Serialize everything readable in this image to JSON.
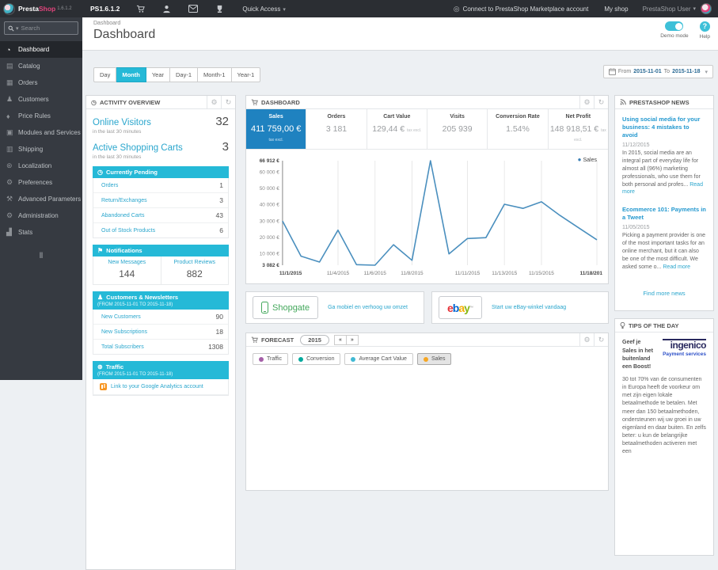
{
  "topbar": {
    "brand_presta": "Presta",
    "brand_shop": "Shop",
    "brand_version": "1.6.1.2",
    "shop_name": "PS1.6.1.2",
    "quick_access": "Quick Access",
    "connect_link": "Connect to PrestaShop Marketplace account",
    "my_shop": "My shop",
    "user_name": "PrestaShop User"
  },
  "sidebar": {
    "search_placeholder": "Search",
    "items": [
      {
        "label": "Dashboard"
      },
      {
        "label": "Catalog"
      },
      {
        "label": "Orders"
      },
      {
        "label": "Customers"
      },
      {
        "label": "Price Rules"
      },
      {
        "label": "Modules and Services"
      },
      {
        "label": "Shipping"
      },
      {
        "label": "Localization"
      },
      {
        "label": "Preferences"
      },
      {
        "label": "Advanced Parameters"
      },
      {
        "label": "Administration"
      },
      {
        "label": "Stats"
      }
    ]
  },
  "icons": {
    "dashboard": "◔",
    "catalog": "▤",
    "orders": "▦",
    "customers": "♟",
    "price_rules": "♦",
    "modules": "▣",
    "shipping": "▥",
    "localization": "⊛",
    "preferences": "⚙",
    "advanced": "⚒",
    "administration": "⚙",
    "stats": "▟",
    "gear": "⚙",
    "refresh": "↻",
    "caret_down": "▾",
    "clock": "◷",
    "bell": "⚑",
    "person": "♟",
    "globe": "⊛",
    "dot": "●",
    "collapse": "‖",
    "prev": "«",
    "next": "»",
    "connect": "◎",
    "help": "?"
  },
  "header": {
    "breadcrumb": "Dashboard",
    "title": "Dashboard",
    "demo_mode": "Demo mode",
    "help": "Help"
  },
  "toolbar": {
    "range_buttons": [
      "Day",
      "Month",
      "Year",
      "Day-1",
      "Month-1",
      "Year-1"
    ],
    "active_range": "Month",
    "from_label": "From",
    "date_from": "2015-11-01",
    "to_label": "To",
    "date_to": "2015-11-18"
  },
  "activity": {
    "title": "ACTIVITY OVERVIEW",
    "online_visitors_label": "Online Visitors",
    "online_visitors_sub": "in the last 30 minutes",
    "online_visitors": "32",
    "active_carts_label": "Active Shopping Carts",
    "active_carts_sub": "in the last 30 minutes",
    "active_carts": "3",
    "pending": {
      "title": "Currently Pending",
      "rows": [
        [
          "Orders",
          "1"
        ],
        [
          "Return/Exchanges",
          "3"
        ],
        [
          "Abandoned Carts",
          "43"
        ],
        [
          "Out of Stock Products",
          "6"
        ]
      ]
    },
    "notifications": {
      "title": "Notifications",
      "cols": [
        [
          "New Messages",
          "144"
        ],
        [
          "Product Reviews",
          "882"
        ]
      ]
    },
    "customers": {
      "title": "Customers & Newsletters",
      "subtitle": "(FROM 2015-11-01 TO 2015-11-18)",
      "rows": [
        [
          "New Customers",
          "90"
        ],
        [
          "New Subscriptions",
          "18"
        ],
        [
          "Total Subscribers",
          "1308"
        ]
      ]
    },
    "traffic": {
      "title": "Traffic",
      "subtitle": "(FROM 2015-11-01 TO 2015-11-18)",
      "link": "Link to your Google Analytics account"
    }
  },
  "dashboard_panel": {
    "title": "DASHBOARD",
    "kpis": [
      {
        "label": "Sales",
        "value": "411 759,00 €",
        "suffix": "tax excl."
      },
      {
        "label": "Orders",
        "value": "3 181",
        "suffix": ""
      },
      {
        "label": "Cart Value",
        "value": "129,44 €",
        "suffix": "tax excl."
      },
      {
        "label": "Visits",
        "value": "205 939",
        "suffix": ""
      },
      {
        "label": "Conversion Rate",
        "value": "1.54%",
        "suffix": ""
      },
      {
        "label": "Net Profit",
        "value": "148 918,51 €",
        "suffix": "tax excl."
      }
    ],
    "legend": "Sales"
  },
  "chart_data": {
    "type": "line",
    "title": "Sales",
    "x": [
      "11/1/2015",
      "11/2/2015",
      "11/3/2015",
      "11/4/2015",
      "11/5/2015",
      "11/6/2015",
      "11/7/2015",
      "11/8/2015",
      "11/9/2015",
      "11/10/2015",
      "11/11/2015",
      "11/12/2015",
      "11/13/2015",
      "11/14/2015",
      "11/15/2015",
      "11/16/2015",
      "11/17/2015",
      "11/18/2015"
    ],
    "series": [
      {
        "name": "Sales",
        "color": "#4a8fbe",
        "values": [
          30000,
          8600,
          5000,
          24500,
          3400,
          3082,
          15600,
          6100,
          66912,
          10000,
          19400,
          19900,
          40300,
          37800,
          41800,
          33500,
          26000,
          18600
        ]
      }
    ],
    "x_tick_idx": [
      0,
      3,
      5,
      7,
      10,
      12,
      14,
      17
    ],
    "x_tick_labels": [
      "11/1/2015",
      "11/4/2015",
      "11/6/2015",
      "11/8/2015",
      "11/11/2015",
      "11/13/2015",
      "11/15/2015",
      "11/18/201"
    ],
    "y_ticks": [
      66912,
      60000,
      50000,
      40000,
      30000,
      20000,
      10000,
      3082
    ],
    "y_tick_labels": [
      "66 912 €",
      "60 000 €",
      "50 000 €",
      "40 000 €",
      "30 000 €",
      "20 000 €",
      "10 000 €",
      "3 082 €"
    ],
    "ylim": [
      3082,
      66912
    ],
    "grid": true,
    "legend_position": "top-right"
  },
  "ads": {
    "shopgate": {
      "brand": "Shopgate",
      "link": "Ga mobiel en verhoog uw omzet"
    },
    "ebay": {
      "brand_letters": [
        "e",
        "b",
        "a",
        "y"
      ],
      "tm": "™",
      "link": "Start uw eBay-winkel vandaag"
    }
  },
  "forecast": {
    "title": "FORECAST",
    "year": "2015",
    "toggles": [
      {
        "label": "Traffic",
        "color": "#a55fa8"
      },
      {
        "label": "Conversion",
        "color": "#00a99d"
      },
      {
        "label": "Average Cart Value",
        "color": "#41b9d4"
      },
      {
        "label": "Sales",
        "color": "#f6a623",
        "active": true
      }
    ]
  },
  "news": {
    "title": "PRESTASHOP NEWS",
    "articles": [
      {
        "title": "Using social media for your business: 4 mistakes to avoid",
        "date": "11/12/2015",
        "excerpt": "In 2015, social media are an integral part of everyday life for almost all (96%) marketing professionals, who use them for both personal and profes...",
        "read_more": "Read more"
      },
      {
        "title": "Ecommerce 101: Payments in a Tweet",
        "date": "11/05/2015",
        "excerpt": "Picking a payment provider is one of the most important tasks for an online merchant, but it can also be one of the most difficult. We asked some o...",
        "read_more": "Read more"
      }
    ],
    "footer_link": "Find more news"
  },
  "tips": {
    "title": "TIPS OF THE DAY",
    "heading": "Geef je Sales in het buitenland een Boost!",
    "logo_word": "ingenico",
    "logo_sub": "Payment services",
    "body": "30 tot 70% van de consumenten in Europa heeft de voorkeur om met zijn eigen lokale betaalmethode te betalen. Met meer dan 150 betaalmethoden, ondersteunen wij uw groei in uw eigenland en daar buiten. En zelfs beter: u kun de belangrijke betaalmethoden activeren met een"
  },
  "colors": {
    "accent_cyan": "#25b9d7",
    "kpi_active_blue": "#1f82c0",
    "link_cyan": "#2aa6cd",
    "sales_line": "#4a8fbe",
    "topbar_bg": "#2b2e33",
    "sidebar_bg": "#363a41",
    "brand_pink": "#e0447c"
  }
}
